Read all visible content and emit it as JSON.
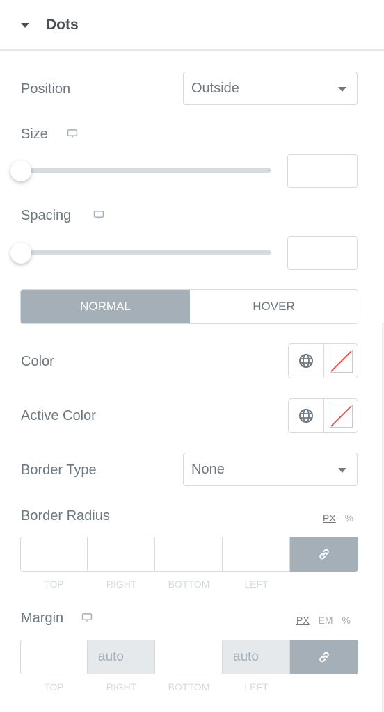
{
  "section": {
    "title": "Dots",
    "expanded": true
  },
  "position": {
    "label": "Position",
    "value": "Outside"
  },
  "size": {
    "label": "Size",
    "responsive_icon": "desktop-icon",
    "value": "",
    "slider_fraction": 0
  },
  "spacing": {
    "label": "Spacing",
    "responsive_icon": "desktop-icon",
    "value": "",
    "slider_fraction": 0
  },
  "state_tabs": [
    {
      "label": "NORMAL",
      "active": true
    },
    {
      "label": "HOVER",
      "active": false
    }
  ],
  "color": {
    "label": "Color",
    "global_icon": "globe-icon",
    "swatch": "none"
  },
  "active_color": {
    "label": "Active Color",
    "global_icon": "globe-icon",
    "swatch": "none"
  },
  "border_type": {
    "label": "Border Type",
    "value": "None"
  },
  "border_radius": {
    "label": "Border Radius",
    "units": [
      "PX",
      "%"
    ],
    "selected_unit": "PX",
    "fields": [
      {
        "label": "TOP",
        "value": "",
        "placeholder": ""
      },
      {
        "label": "RIGHT",
        "value": "",
        "placeholder": ""
      },
      {
        "label": "BOTTOM",
        "value": "",
        "placeholder": ""
      },
      {
        "label": "LEFT",
        "value": "",
        "placeholder": ""
      }
    ],
    "link_icon": "link-icon"
  },
  "margin": {
    "label": "Margin",
    "responsive_icon": "desktop-icon",
    "units": [
      "PX",
      "EM",
      "%"
    ],
    "selected_unit": "PX",
    "fields": [
      {
        "label": "TOP",
        "value": "",
        "placeholder": ""
      },
      {
        "label": "RIGHT",
        "value": "",
        "placeholder": "auto"
      },
      {
        "label": "BOTTOM",
        "value": "",
        "placeholder": ""
      },
      {
        "label": "LEFT",
        "value": "",
        "placeholder": "auto"
      }
    ],
    "link_icon": "link-icon"
  },
  "colors": {
    "accent_grey": "#a4afb7",
    "text": "#6d7882",
    "border": "#d5dadf",
    "swatch_none": "#ff3b3b"
  }
}
